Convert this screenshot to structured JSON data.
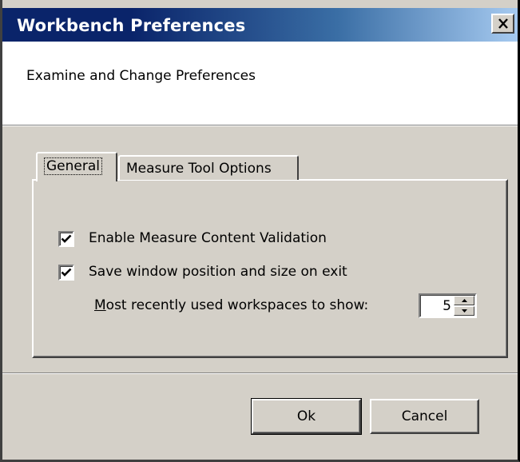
{
  "window": {
    "title": "Workbench Preferences",
    "close_icon": "close-x-icon"
  },
  "header": {
    "text": "Examine and Change Preferences"
  },
  "tabs": [
    {
      "label": "General",
      "selected": true
    },
    {
      "label": "Measure Tool Options",
      "selected": false
    }
  ],
  "general": {
    "options": [
      {
        "label": "Enable Measure Content Validation",
        "checked": true
      },
      {
        "label": "Save window position and size on exit",
        "checked": true
      }
    ],
    "mru_label_first": "M",
    "mru_label_rest": "ost recently used workspaces to show:",
    "mru_value": "5"
  },
  "buttons": {
    "ok": "Ok",
    "cancel": "Cancel"
  },
  "colors": {
    "title_start": "#0a246a",
    "title_end": "#a6caf0",
    "face": "#d4d0c8"
  }
}
